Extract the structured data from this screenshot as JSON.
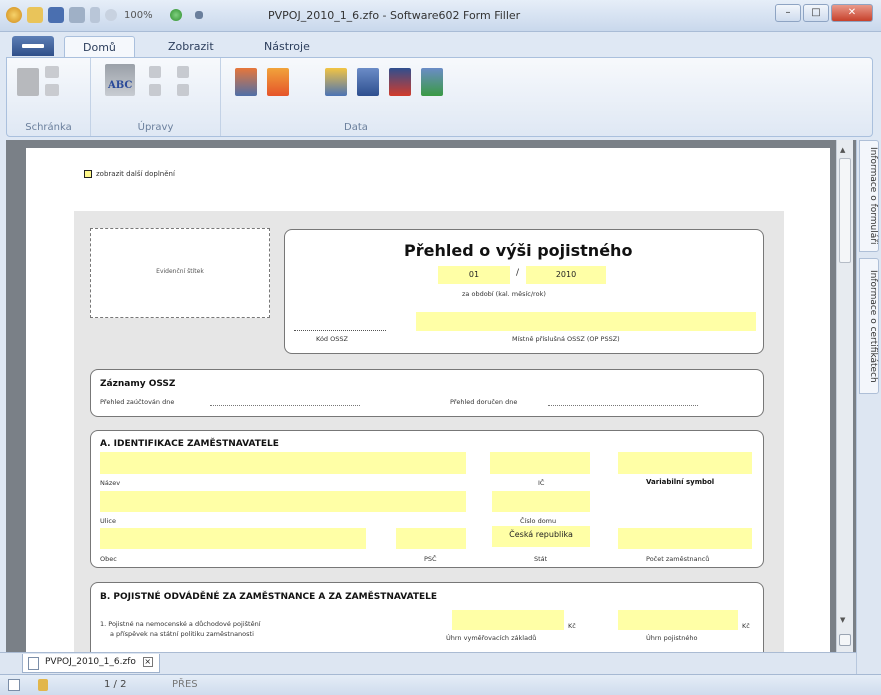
{
  "window": {
    "title": "PVPOJ_2010_1_6.zfo - Software602 Form Filler",
    "zoom": "100%"
  },
  "ribbon": {
    "tabs": [
      {
        "label": "Domů",
        "active": true
      },
      {
        "label": "Zobrazit",
        "active": false
      },
      {
        "label": "Nástroje",
        "active": false
      }
    ],
    "groups": {
      "clipboard": "Schránka",
      "edit": "Úpravy",
      "data": "Data"
    },
    "abc_label": "ABC"
  },
  "side_panel": {
    "tabs": [
      "Informace o formuláři",
      "Informace o certifikátech"
    ]
  },
  "form": {
    "toggle_label": "zobrazit další doplnění",
    "stamp_label": "Evidenční štítek",
    "title": "Přehled o výši pojistného",
    "period": {
      "month": "01",
      "sep": "/",
      "year": "2010"
    },
    "period_label": "za období (kal. měsíc/rok)",
    "kod_ossz_label": "Kód OSSZ",
    "mistne_label": "Místně příslušná OSSZ (OP PSSZ)",
    "records": {
      "heading": "Záznamy OSSZ",
      "zauctovan": "Přehled zaúčtován dne",
      "dorucen": "Přehled doručen dne"
    },
    "section_a": {
      "heading": "A. IDENTIFIKACE ZAMĚSTNAVATELE",
      "nazev": "Název",
      "ic": "IČ",
      "variabilni_symbol": "Variabilní symbol",
      "ulice": "Ulice",
      "cislo_domu": "Číslo domu",
      "obec": "Obec",
      "psc": "PSČ",
      "stat_value": "Česká republika",
      "stat": "Stát",
      "pocet": "Počet zaměstnanců"
    },
    "section_b": {
      "heading": "B. POJISTNÉ ODVÁDĚNÉ ZA ZAMĚSTNANCE A ZA ZAMĚSTNAVATELE",
      "item1_line1": "1. Pojistné na nemocenské a důchodové pojištění",
      "item1_line2": "a příspěvek na státní politiku zaměstnanosti",
      "kc": "Kč",
      "uhrn_zakladu": "Úhrn vyměřovacích základů",
      "uhrn_pojistneho": "Úhrn pojistného"
    }
  },
  "doc_tab": {
    "label": "PVPOJ_2010_1_6.zfo",
    "close": "×"
  },
  "status": {
    "page": "1 / 2",
    "mode": "PŘES"
  }
}
